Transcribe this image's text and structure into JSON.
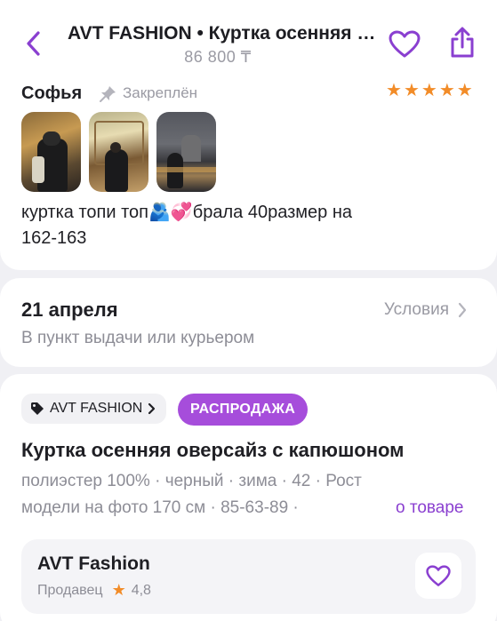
{
  "header": {
    "title": "AVT FASHION • Куртка осенняя оверсайз с капюшоном",
    "price": "86 800 ₸",
    "back_icon": "chevron-left-icon",
    "favorite_icon": "heart-icon",
    "share_icon": "share-icon",
    "accent_color": "#8a3fd0"
  },
  "review": {
    "author": "Софья",
    "pinned_label": "Закреплён",
    "rating": 5,
    "star_glyph": "★",
    "star_color": "#f28c28",
    "photos": [
      "photo-1",
      "photo-2",
      "photo-3"
    ],
    "text_line1": "куртка топи топ🫂💞брала 40размер на",
    "text_line2": "162-163"
  },
  "delivery": {
    "date": "21 апреля",
    "subtitle": "В пункт выдачи или курьером",
    "conditions_label": "Условия"
  },
  "product": {
    "brand_chip": "AVT FASHION",
    "sale_chip": "РАСПРОДАЖА",
    "sale_color": "#a64ddb",
    "name": "Куртка осенняя оверсайз с капюшоном",
    "attributes_line1": "полиэстер 100% · черный · зима · 42 · Рост",
    "attributes_line2": "модели на фото 170 см · 85-63-89 ·",
    "about_link": "о товаре"
  },
  "seller": {
    "name": "AVT Fashion",
    "role": "Продавец",
    "rating": "4,8"
  }
}
